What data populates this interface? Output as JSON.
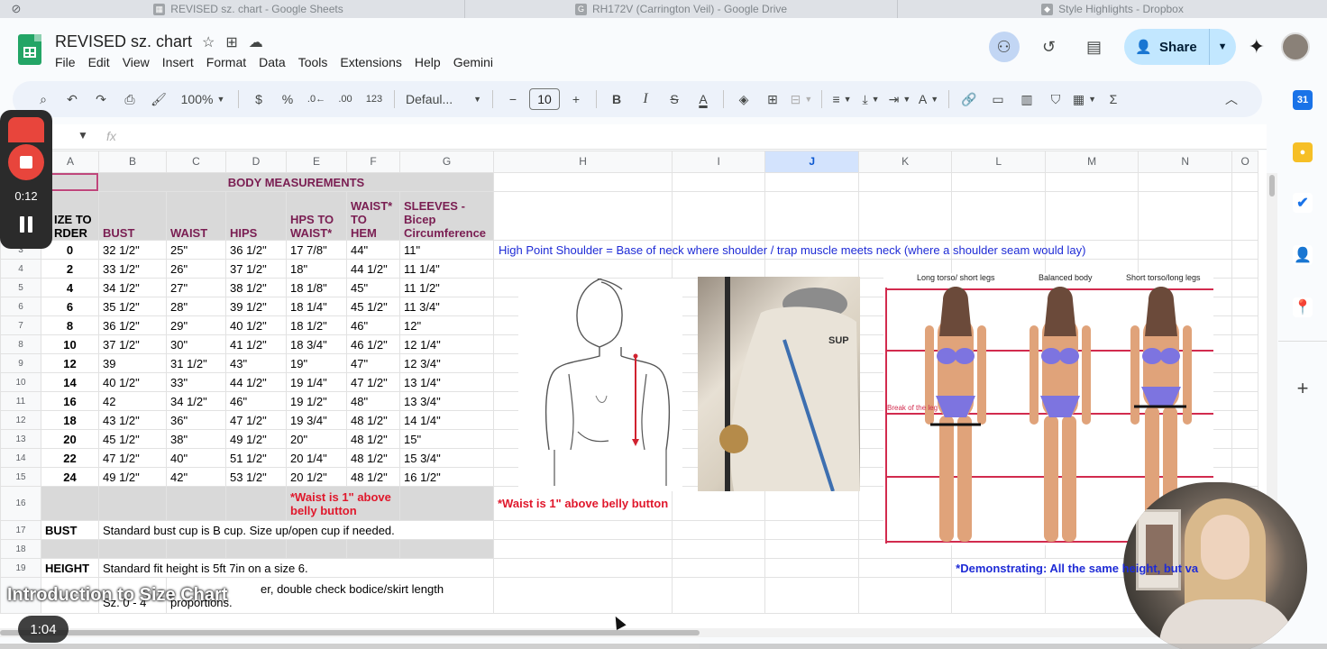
{
  "browser_tabs": [
    {
      "label": "REVISED sz. chart - Google Sheets",
      "icon": "sheets-icon"
    },
    {
      "label": "RH172V (Carrington Veil) - Google Drive",
      "icon": "drive-icon"
    },
    {
      "label": "Style Highlights - Dropbox",
      "icon": "dropbox-icon"
    }
  ],
  "doc": {
    "title": "REVISED sz. chart"
  },
  "menu": [
    "File",
    "Edit",
    "View",
    "Insert",
    "Format",
    "Data",
    "Tools",
    "Extensions",
    "Help",
    "Gemini"
  ],
  "share": {
    "label": "Share"
  },
  "toolbar": {
    "zoom": "100%",
    "currency": "$",
    "percent": "%",
    "dec_decrease": ".0←",
    "dec_increase": ".00",
    "number_format": "123",
    "font": "Defaul...",
    "font_size": "10",
    "bold": "B",
    "italic": "I",
    "sum": "Σ"
  },
  "formula_bar": {
    "fx": "fx"
  },
  "columns": [
    "A",
    "B",
    "C",
    "D",
    "E",
    "F",
    "G",
    "H",
    "I",
    "J",
    "K",
    "L",
    "M",
    "N",
    "O"
  ],
  "sheet": {
    "header_title": "BODY MEASUREMENTS",
    "col_headers": {
      "a": "IZE TO\nRDER",
      "b": "BUST",
      "c": "WAIST",
      "d": "HIPS",
      "e": "HPS TO\nWAIST*",
      "f": "WAIST*\nTO\nHEM",
      "g": "SLEEVES -\nBicep\nCircumference"
    },
    "rows": [
      {
        "n": "3",
        "size": "0",
        "bust": "32 1/2\"",
        "waist": "25\"",
        "hips": "36 1/2\"",
        "hps": "17 7/8\"",
        "hem": "44\"",
        "sleeve": "11\""
      },
      {
        "n": "4",
        "size": "2",
        "bust": "33 1/2\"",
        "waist": "26\"",
        "hips": "37 1/2\"",
        "hps": "18\"",
        "hem": "44 1/2\"",
        "sleeve": "11 1/4\""
      },
      {
        "n": "5",
        "size": "4",
        "bust": "34 1/2\"",
        "waist": "27\"",
        "hips": "38 1/2\"",
        "hps": "18 1/8\"",
        "hem": "45\"",
        "sleeve": "11 1/2\""
      },
      {
        "n": "6",
        "size": "6",
        "bust": "35 1/2\"",
        "waist": "28\"",
        "hips": "39 1/2\"",
        "hps": "18 1/4\"",
        "hem": "45 1/2\"",
        "sleeve": "11 3/4\""
      },
      {
        "n": "7",
        "size": "8",
        "bust": "36 1/2\"",
        "waist": "29\"",
        "hips": "40 1/2\"",
        "hps": "18 1/2\"",
        "hem": "46\"",
        "sleeve": "12\""
      },
      {
        "n": "8",
        "size": "10",
        "bust": "37 1/2\"",
        "waist": "30\"",
        "hips": "41 1/2\"",
        "hps": "18 3/4\"",
        "hem": "46 1/2\"",
        "sleeve": "12 1/4\""
      },
      {
        "n": "9",
        "size": "12",
        "bust": "39",
        "waist": "31 1/2\"",
        "hips": "43\"",
        "hps": "19\"",
        "hem": "47\"",
        "sleeve": "12 3/4\""
      },
      {
        "n": "10",
        "size": "14",
        "bust": "40 1/2\"",
        "waist": "33\"",
        "hips": "44 1/2\"",
        "hps": "19 1/4\"",
        "hem": "47 1/2\"",
        "sleeve": "13 1/4\""
      },
      {
        "n": "11",
        "size": "16",
        "bust": "42",
        "waist": "34 1/2\"",
        "hips": "46\"",
        "hps": "19 1/2\"",
        "hem": "48\"",
        "sleeve": "13 3/4\""
      },
      {
        "n": "12",
        "size": "18",
        "bust": "43 1/2\"",
        "waist": "36\"",
        "hips": "47 1/2\"",
        "hps": "19 3/4\"",
        "hem": "48 1/2\"",
        "sleeve": "14 1/4\""
      },
      {
        "n": "13",
        "size": "20",
        "bust": "45 1/2\"",
        "waist": "38\"",
        "hips": "49 1/2\"",
        "hps": "20\"",
        "hem": "48 1/2\"",
        "sleeve": "15\""
      },
      {
        "n": "14",
        "size": "22",
        "bust": "47 1/2\"",
        "waist": "40\"",
        "hips": "51 1/2\"",
        "hps": "20 1/4\"",
        "hem": "48 1/2\"",
        "sleeve": "15 3/4\""
      },
      {
        "n": "15",
        "size": "24",
        "bust": "49 1/2\"",
        "waist": "42\"",
        "hips": "53 1/2\"",
        "hps": "20 1/2\"",
        "hem": "48 1/2\"",
        "sleeve": "16 1/2\""
      }
    ],
    "hps_note": "High Point Shoulder = Base of neck where shoulder / trap muscle meets neck (where a shoulder seam would lay)",
    "waist_note_e": "*Waist is 1\" above belly button",
    "waist_note_h": "*Waist is 1\" above belly button",
    "bust_label": "BUST",
    "bust_note": "Standard bust cup is B cup. Size up/open cup if needed.",
    "height_label": "HEIGHT",
    "height_note": "Standard fit height is 5ft 7in on a size 6.",
    "row20_b": "Sz. 0 - 4",
    "row20_c_top": "er, double check bodice/skirt length",
    "row20_c": "proportions.",
    "demo_note": "*Demonstrating: All the same height, but va",
    "body_types": [
      "Long torso/ short legs",
      "Balanced body",
      "Short torso/long legs"
    ],
    "break_label": "Break of the leg"
  },
  "recorder": {
    "time": "0:12"
  },
  "video": {
    "title": "Introduction to Size Chart",
    "time": "1:04",
    "progress": 0.527
  },
  "side_panel": [
    "Calendar",
    "Keep",
    "Tasks",
    "Contacts",
    "Maps"
  ],
  "colors": {
    "sheets_green": "#23a566",
    "header_purple": "#7a1e52",
    "note_blue": "#1e2bd6",
    "note_red": "#e0182c",
    "share_blue": "#c2e7ff",
    "record_red": "#e8453c"
  }
}
